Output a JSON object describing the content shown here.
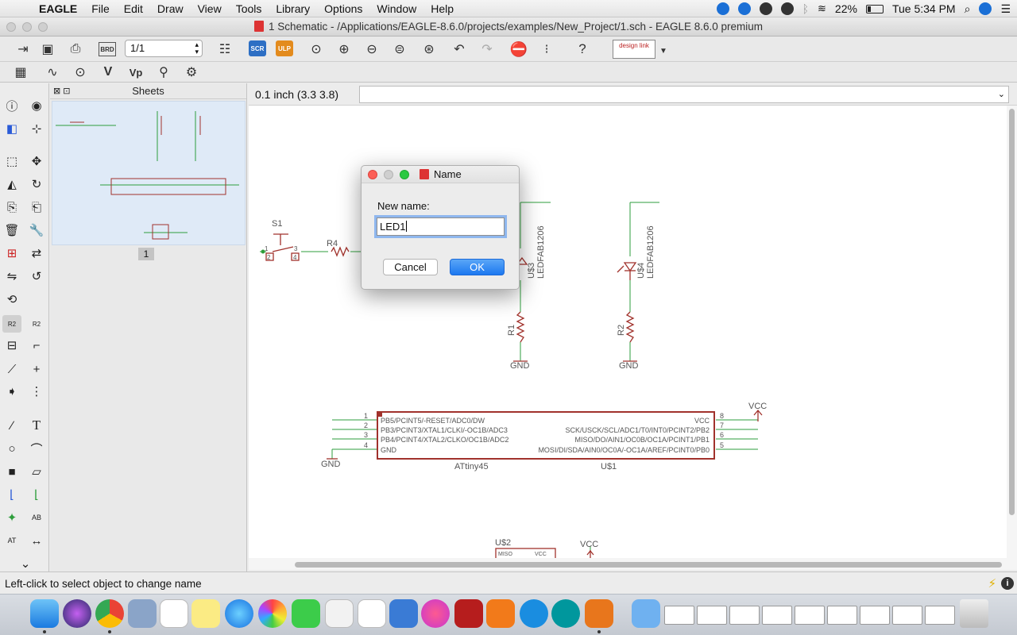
{
  "menubar": {
    "app_name": "EAGLE",
    "items": [
      "File",
      "Edit",
      "Draw",
      "View",
      "Tools",
      "Library",
      "Options",
      "Window",
      "Help"
    ],
    "battery": "22%",
    "clock": "Tue 5:34 PM"
  },
  "window": {
    "title": "1 Schematic - /Applications/EAGLE-8.6.0/projects/examples/New_Project/1.sch - EAGLE 8.6.0 premium"
  },
  "toolbar": {
    "sheet_selector": "1/1",
    "scr_label": "SCR",
    "ulp_label": "ULP",
    "brd_label": "BRD",
    "designlink_label": "design link"
  },
  "sheets_panel": {
    "title": "Sheets",
    "sheet_number": "1"
  },
  "command_row": {
    "grid_readout": "0.1 inch (3.3 3.8)",
    "command_value": ""
  },
  "schematic": {
    "labels": {
      "s1": "S1",
      "r4": "R4",
      "pin1": "1",
      "pin2": "2",
      "pin3": "3",
      "pin4": "4",
      "u3": "U$3",
      "u4": "U$4",
      "led_value_a": "LEDFAB1206",
      "led_value_b": "LEDFAB1206",
      "r1": "R1",
      "r2": "R2",
      "gnd_a": "GND",
      "gnd_b": "GND",
      "gnd_c": "GND",
      "vcc_a": "VCC",
      "vcc_b": "VCC",
      "chip_name": "ATtiny45",
      "chip_ref": "U$1",
      "u2": "U$2",
      "miso": "MISO",
      "vcc_small": "VCC"
    },
    "chip_pins_left": [
      {
        "num": "1",
        "name": "PB5/PCINT5/-RESET/ADC0/DW"
      },
      {
        "num": "2",
        "name": "PB3/PCINT3/XTAL1/CLKI/-OC1B/ADC3"
      },
      {
        "num": "3",
        "name": "PB4/PCINT4/XTAL2/CLKO/OC1B/ADC2"
      },
      {
        "num": "4",
        "name": "GND"
      }
    ],
    "chip_pins_right": [
      {
        "num": "8",
        "name": "VCC"
      },
      {
        "num": "7",
        "name": "SCK/USCK/SCL/ADC1/T0/INT0/PCINT2/PB2"
      },
      {
        "num": "6",
        "name": "MISO/DO/AIN1/OC0B/OC1A/PCINT1/PB1"
      },
      {
        "num": "5",
        "name": "MOSI/DI/SDA/AIN0/OC0A/-OC1A/AREF/PCINT0/PB0"
      }
    ]
  },
  "dialog": {
    "title": "Name",
    "prompt": "New name:",
    "value": "LED1",
    "cancel_label": "Cancel",
    "ok_label": "OK"
  },
  "status": {
    "message": "Left-click to select object to change name"
  },
  "colors": {
    "wire": "#2e9e3c",
    "part": "#a1322c",
    "label": "#555555",
    "accent": "#1c78f0"
  }
}
